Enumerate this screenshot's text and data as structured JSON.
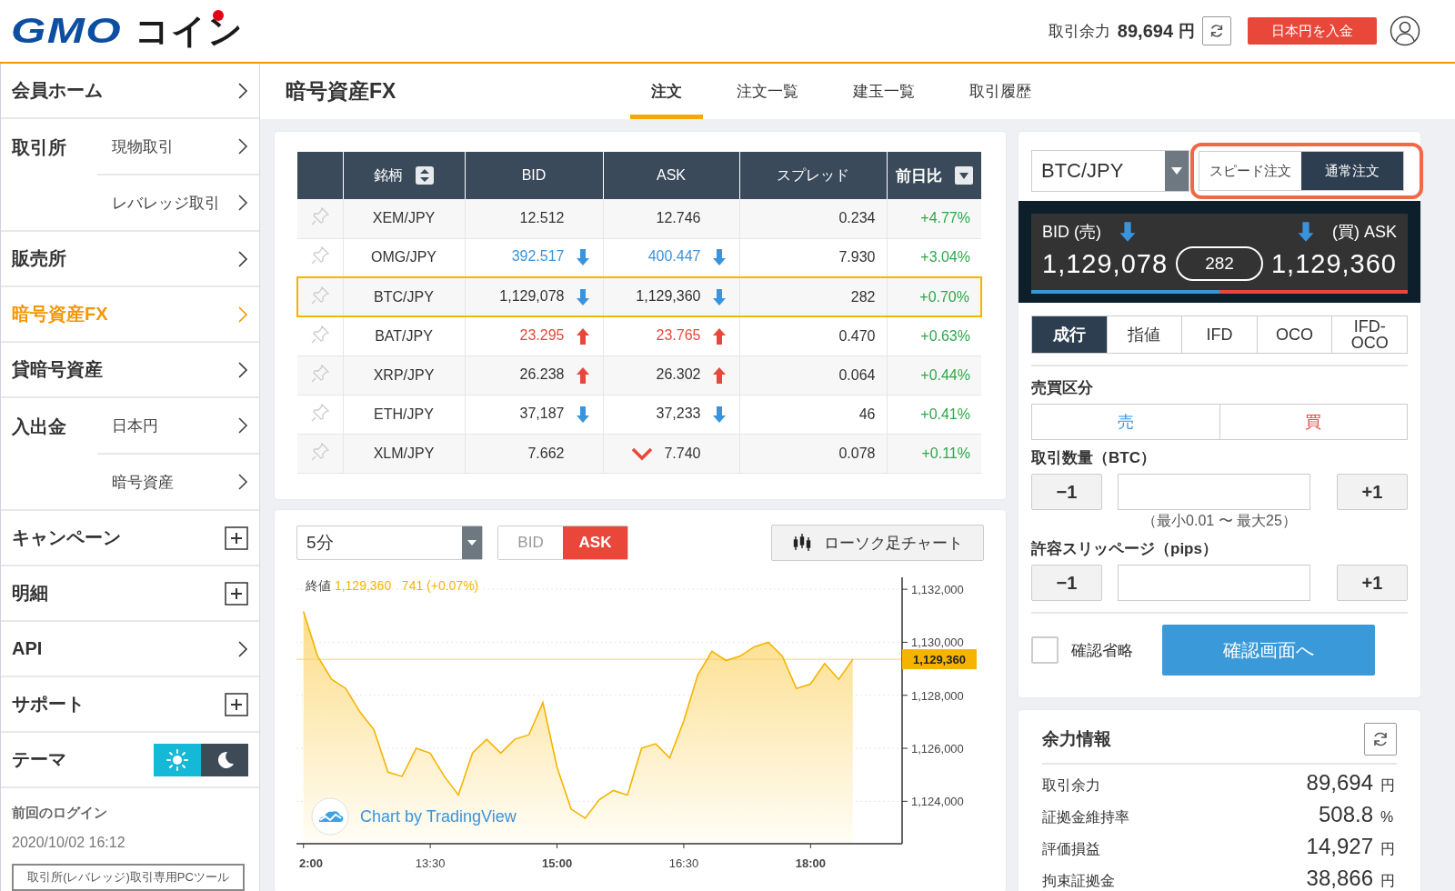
{
  "header": {
    "logo": [
      "GMO",
      "コイン"
    ],
    "balance": {
      "label": "取引余力",
      "value": "89,694",
      "unit": "円"
    },
    "deposit_button": "日本円を入金"
  },
  "sidebar": {
    "items": [
      {
        "kind": "link",
        "label": "会員ホーム",
        "selected": false
      },
      {
        "kind": "group",
        "label": "取引所",
        "selected": false,
        "children": [
          {
            "label": "現物取引",
            "selected": false
          },
          {
            "label": "レバレッジ取引",
            "selected": false
          }
        ]
      },
      {
        "kind": "link",
        "label": "販売所",
        "selected": false
      },
      {
        "kind": "link",
        "label": "暗号資産FX",
        "selected": true
      },
      {
        "kind": "link",
        "label": "貸暗号資産",
        "selected": false
      },
      {
        "kind": "group",
        "label": "入出金",
        "selected": false,
        "children": [
          {
            "label": "日本円",
            "selected": false
          },
          {
            "label": "暗号資産",
            "selected": false
          }
        ]
      },
      {
        "kind": "expand",
        "label": "キャンペーン",
        "selected": false
      },
      {
        "kind": "expand",
        "label": "明細",
        "selected": false
      },
      {
        "kind": "link",
        "label": "API",
        "selected": false
      },
      {
        "kind": "expand",
        "label": "サポート",
        "selected": false
      },
      {
        "kind": "theme",
        "label": "テーマ",
        "selected": false,
        "options": [
          {
            "kind": "light",
            "selected": true
          },
          {
            "kind": "dark",
            "selected": false
          }
        ]
      }
    ],
    "last_login": {
      "label": "前回のログイン",
      "value": "2020/10/02 16:12"
    },
    "tool_button": "取引所(レバレッジ)取引専用PCツール"
  },
  "page": {
    "title": "暗号資産FX",
    "tabs": [
      {
        "label": "注文",
        "selected": true
      },
      {
        "label": "注文一覧",
        "selected": false
      },
      {
        "label": "建玉一覧",
        "selected": false
      },
      {
        "label": "取引履歴",
        "selected": false
      }
    ]
  },
  "rates_table": {
    "columns": [
      "銘柄",
      "BID",
      "ASK",
      "スプレッド",
      "前日比"
    ],
    "rows": [
      {
        "pair": "XEM/JPY",
        "bid": {
          "text": "12.512",
          "kind": "plain"
        },
        "ask": {
          "text": "12.746",
          "kind": "plain"
        },
        "spread": "0.234",
        "change": "+4.77%",
        "selected": false
      },
      {
        "pair": "OMG/JPY",
        "bid": {
          "text": "392.517",
          "kind": "down",
          "color": "#3a94dc"
        },
        "ask": {
          "text": "400.447",
          "kind": "down",
          "color": "#3a94dc"
        },
        "spread": "7.930",
        "change": "+3.04%",
        "selected": false
      },
      {
        "pair": "BTC/JPY",
        "bid": {
          "text": "1,129,078",
          "kind": "down"
        },
        "ask": {
          "text": "1,129,360",
          "kind": "down"
        },
        "spread": "282",
        "change": "+0.70%",
        "selected": true
      },
      {
        "pair": "BAT/JPY",
        "bid": {
          "text": "23.295",
          "kind": "up",
          "color": "#e8473a"
        },
        "ask": {
          "text": "23.765",
          "kind": "up",
          "color": "#e8473a"
        },
        "spread": "0.470",
        "change": "+0.63%",
        "selected": false
      },
      {
        "pair": "XRP/JPY",
        "bid": {
          "text": "26.238",
          "kind": "up"
        },
        "ask": {
          "text": "26.302",
          "kind": "up"
        },
        "spread": "0.064",
        "change": "+0.44%",
        "selected": false
      },
      {
        "pair": "ETH/JPY",
        "bid": {
          "text": "37,187",
          "kind": "down"
        },
        "ask": {
          "text": "37,233",
          "kind": "down"
        },
        "spread": "46",
        "change": "+0.41%",
        "selected": false
      },
      {
        "pair": "XLM/JPY",
        "bid": {
          "text": "7.662",
          "kind": "plain"
        },
        "ask": {
          "text": "7.740",
          "kind": "drop"
        },
        "spread": "0.078",
        "change": "+0.11%",
        "selected": false
      }
    ]
  },
  "chart_panel": {
    "interval": "5分",
    "price_sides": [
      {
        "label": "BID",
        "selected": false
      },
      {
        "label": "ASK",
        "selected": true
      }
    ],
    "style_button": "ローソク足チャート",
    "legend": {
      "price": "1,129,360",
      "change": "741 (+0.07%)"
    },
    "attribution": "Chart by TradingView",
    "chart_data": {
      "type": "area",
      "grid": true,
      "categories": [
        "2:00",
        null,
        null,
        null,
        null,
        null,
        null,
        null,
        null,
        "13:30",
        null,
        null,
        null,
        null,
        null,
        null,
        null,
        null,
        "15:00",
        null,
        null,
        null,
        null,
        null,
        null,
        null,
        null,
        "16:30",
        null,
        null,
        null,
        null,
        null,
        null,
        null,
        null,
        "18:00",
        null,
        null,
        null,
        null,
        null,
        null
      ],
      "series": [
        {
          "name": "終値",
          "color": "#f5b400",
          "values": [
            1131160,
            1129480,
            1128600,
            1128260,
            1127380,
            1126700,
            1125100,
            1124940,
            1126000,
            1125820,
            1124940,
            1124240,
            1125820,
            1126340,
            1125820,
            1126340,
            1126510,
            1127730,
            1125290,
            1123710,
            1123360,
            1124060,
            1124410,
            1124240,
            1126000,
            1126170,
            1125640,
            1127030,
            1128780,
            1129660,
            1129310,
            1129480,
            1129830,
            1130000,
            1129480,
            1128260,
            1128430,
            1129200,
            1128600,
            1129360,
            null,
            null,
            null
          ]
        }
      ],
      "ylim": [
        1122400,
        1132450
      ],
      "yticks": [
        {
          "value": 1124000,
          "label": "1,124,000"
        },
        {
          "value": 1126000,
          "label": "1,126,000"
        },
        {
          "value": 1128000,
          "label": "1,128,000"
        },
        {
          "value": 1130000,
          "label": "1,130,000"
        },
        {
          "value": 1132000,
          "label": "1,132,000"
        }
      ],
      "ref_lines": [
        {
          "axis": "y",
          "value": 1129360,
          "label": "1,129,360"
        }
      ]
    }
  },
  "order_panel": {
    "symbol": "BTC/JPY",
    "modes": [
      {
        "label": "スピード注文",
        "selected": false
      },
      {
        "label": "通常注文",
        "selected": true
      }
    ],
    "quote": {
      "bid_label": "BID (売)",
      "bid": {
        "text": "1,129,078",
        "kind": "down"
      },
      "spread": "282",
      "ask_label": "(買) ASK",
      "ask": {
        "text": "1,129,360",
        "kind": "down"
      }
    },
    "order_types": [
      {
        "label": "成行",
        "selected": true
      },
      {
        "label": "指値",
        "selected": false
      },
      {
        "label": "IFD",
        "selected": false
      },
      {
        "label": "OCO",
        "selected": false
      },
      {
        "label": "IFD-OCO",
        "selected": false
      }
    ],
    "side": {
      "label": "売買区分",
      "options": [
        {
          "kind": "sell",
          "label": "売",
          "selected": false
        },
        {
          "kind": "buy",
          "label": "買",
          "selected": false
        }
      ]
    },
    "quantity": {
      "label": "取引数量（BTC）",
      "minus": "−1",
      "plus": "+1",
      "hint": "（最小0.01 〜 最大25）"
    },
    "slippage": {
      "label": "許容スリッページ（pips）",
      "minus": "−1",
      "plus": "+1"
    },
    "skip_confirm": {
      "label": "確認省略",
      "checked": false
    },
    "confirm_button": "確認画面へ"
  },
  "margin_panel": {
    "title": "余力情報",
    "rows": [
      {
        "label": "取引余力",
        "value": "89,694",
        "unit": "円"
      },
      {
        "label": "証拠金維持率",
        "value": "508.8",
        "unit": "%"
      },
      {
        "label": "評価損益",
        "value": "14,927",
        "unit": "円"
      },
      {
        "label": "拘束証拠金",
        "value": "38,866",
        "unit": "円"
      }
    ]
  }
}
